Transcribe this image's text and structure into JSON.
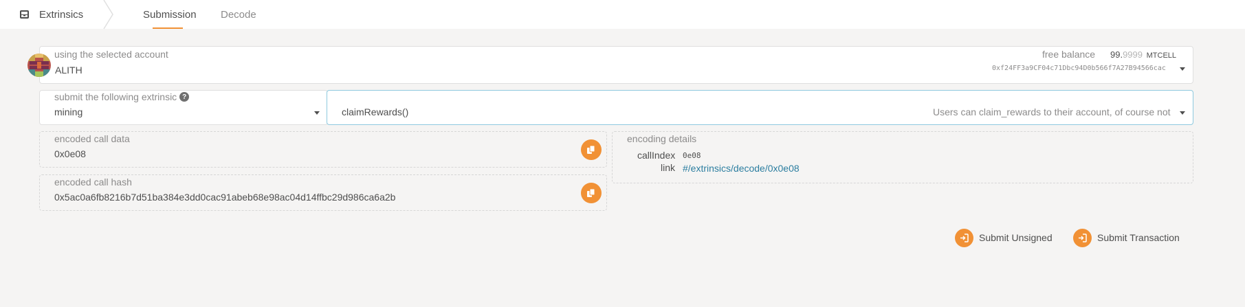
{
  "header": {
    "brand_label": "Extrinsics",
    "tabs": [
      {
        "label": "Submission",
        "active": true
      },
      {
        "label": "Decode",
        "active": false
      }
    ]
  },
  "account": {
    "label": "using the selected account",
    "name": "ALITH",
    "balance_label": "free balance",
    "balance_int": "99.",
    "balance_frac": "9999",
    "balance_unit": "MTCELL",
    "address": "0xf24FF3a9CF04c71Dbc94D0b566f7A27B94566cac"
  },
  "extrinsic": {
    "label": "submit the following extrinsic",
    "module": "mining",
    "method": "claimRewards()",
    "description": "Users can claim_rewards to their account, of course not"
  },
  "encoded_call": {
    "label": "encoded call data",
    "value": "0x0e08"
  },
  "encoded_hash": {
    "label": "encoded call hash",
    "value": "0x5ac0a6fb8216b7d51ba384e3dd0cac91abeb68e98ac04d14ffbc29d986ca6a2b"
  },
  "encoding_details": {
    "label": "encoding details",
    "call_index_label": "callIndex",
    "call_index_value": "0e08",
    "link_label": "link",
    "link_value": "#/extrinsics/decode/0x0e08"
  },
  "actions": {
    "submit_unsigned": "Submit Unsigned",
    "submit_transaction": "Submit Transaction"
  },
  "colors": {
    "accent": "#f19135",
    "link": "#2c7ea0",
    "background": "#f5f4f3"
  },
  "icons": {
    "brand": "envelope-icon",
    "copy": "copy-icon",
    "submit": "sign-in-icon",
    "help": "question-circle-icon",
    "dropdown": "caret-down-icon"
  }
}
